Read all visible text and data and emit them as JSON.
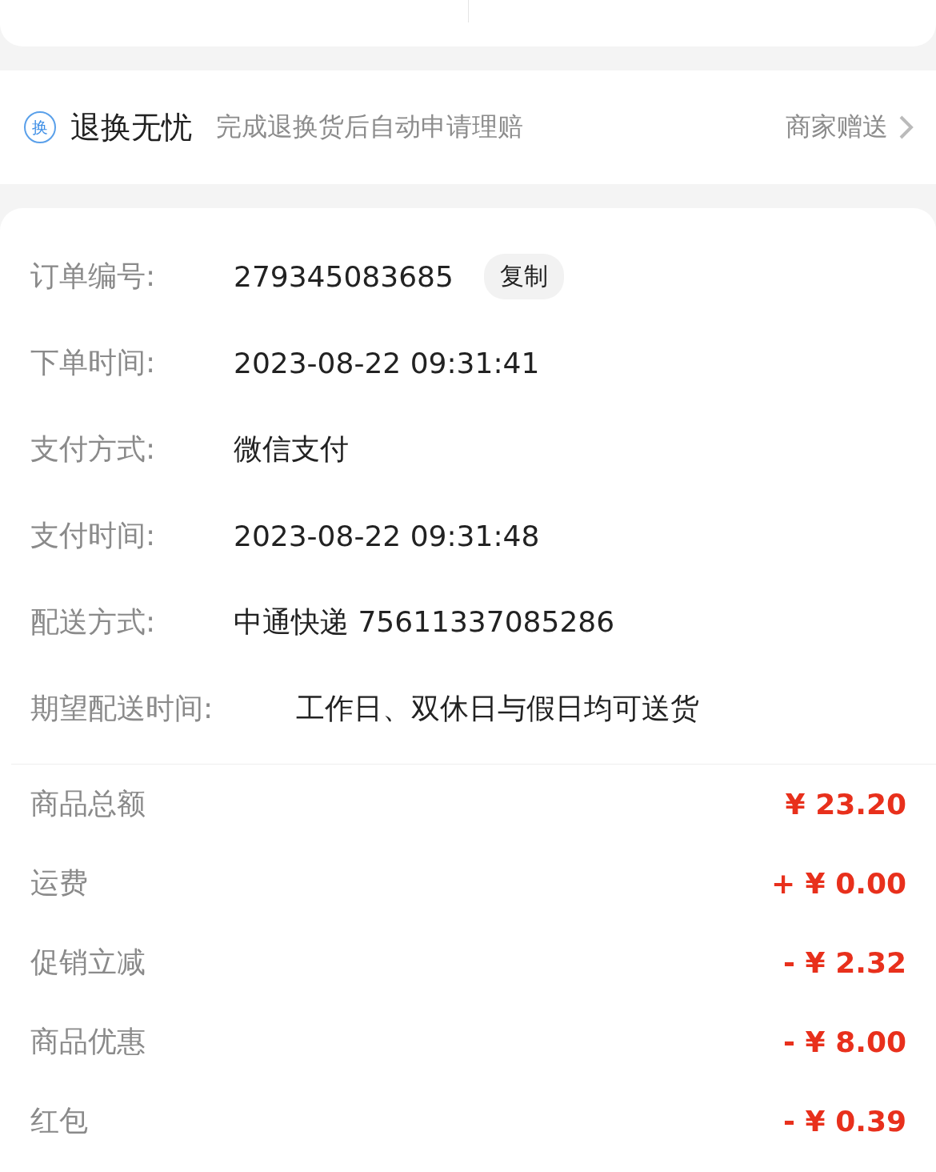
{
  "guarantee": {
    "badge": "换",
    "title": "退换无忧",
    "description": "完成退换货后自动申请理赔",
    "note": "商家赠送"
  },
  "order_info": [
    {
      "kind": "copyable",
      "label": "订单编号:",
      "value": "279345083685",
      "action": "复制"
    },
    {
      "kind": "plain",
      "label": "下单时间:",
      "value": "2023-08-22 09:31:41"
    },
    {
      "kind": "plain",
      "label": "支付方式:",
      "value": "微信支付"
    },
    {
      "kind": "plain",
      "label": "支付时间:",
      "value": "2023-08-22 09:31:48"
    },
    {
      "kind": "plain",
      "label": "配送方式:",
      "value": "中通快递 75611337085286"
    },
    {
      "kind": "wide",
      "label": "期望配送时间:",
      "value": "工作日、双休日与假日均可送货"
    }
  ],
  "amounts": [
    {
      "label": "商品总额",
      "value": "¥ 23.20"
    },
    {
      "label": "运费",
      "value": "+ ¥ 0.00"
    },
    {
      "label": "促销立减",
      "value": "- ¥ 2.32"
    },
    {
      "label": "商品优惠",
      "value": "- ¥ 8.00"
    },
    {
      "label": "红包",
      "value": "- ¥ 0.39"
    }
  ]
}
